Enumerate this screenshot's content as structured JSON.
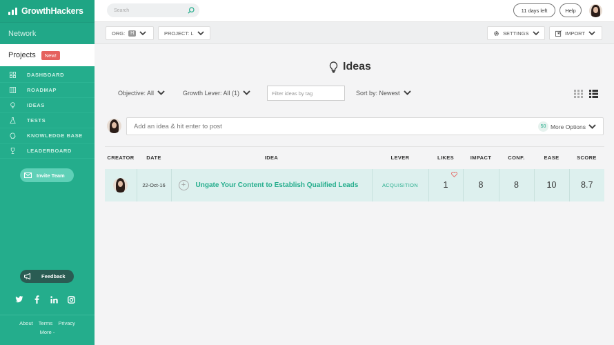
{
  "brand": {
    "name": "GrowthHackers"
  },
  "sidebar": {
    "network_label": "Network",
    "projects_label": "Projects",
    "new_badge": "New!",
    "nav": [
      {
        "label": "DASHBOARD",
        "icon": "dashboard-icon"
      },
      {
        "label": "ROADMAP",
        "icon": "roadmap-icon"
      },
      {
        "label": "IDEAS",
        "icon": "lightbulb-icon"
      },
      {
        "label": "TESTS",
        "icon": "flask-icon"
      },
      {
        "label": "KNOWLEDGE BASE",
        "icon": "brain-icon"
      },
      {
        "label": "LEADERBOARD",
        "icon": "trophy-icon"
      }
    ],
    "invite_label": "Invite Team",
    "feedback_label": "Feedback",
    "footer": {
      "about": "About",
      "terms": "Terms",
      "privacy": "Privacy",
      "more": "More -"
    }
  },
  "topbar": {
    "search_placeholder": "Search",
    "trial_label": "11 days left",
    "help_label": "Help"
  },
  "subbar": {
    "org_label": "ORG:",
    "org_badge": "H",
    "project_label": "PROJECT: L",
    "settings_label": "SETTINGS",
    "import_label": "IMPORT"
  },
  "page": {
    "title": "Ideas",
    "filters": {
      "objective": "Objective: All",
      "growth_lever": "Growth Lever: All (1)",
      "tag_placeholder": "Filter ideas by tag",
      "sort": "Sort by: Newest"
    },
    "post": {
      "placeholder": "Add an idea & hit enter to post",
      "count": "50",
      "more_options": "More Options"
    },
    "table": {
      "headers": [
        "CREATOR",
        "DATE",
        "IDEA",
        "LEVER",
        "LIKES",
        "IMPACT",
        "CONF.",
        "EASE",
        "SCORE"
      ],
      "rows": [
        {
          "date": "22-Oct-16",
          "idea": "Ungate Your Content to Establish Qualified Leads",
          "lever": "ACQUISITION",
          "likes": "1",
          "impact": "8",
          "conf": "8",
          "ease": "10",
          "score": "8.7"
        }
      ]
    }
  },
  "colors": {
    "brand_green": "#24ad8c",
    "row_bg": "#ddf0ee",
    "badge_red": "#e5625e"
  }
}
